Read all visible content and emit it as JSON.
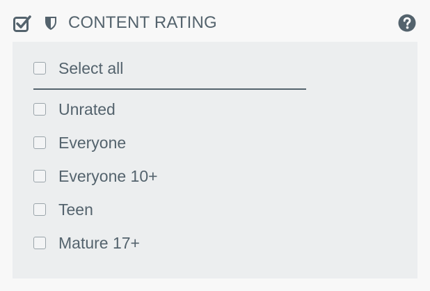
{
  "header": {
    "title": "CONTENT RATING",
    "check_icon": "checkbox-checked-icon",
    "shield_icon": "shield-icon",
    "help_icon": "question-circle-icon"
  },
  "select_all": {
    "label": "Select all",
    "checked": false
  },
  "options": [
    {
      "label": "Unrated",
      "checked": false
    },
    {
      "label": "Everyone",
      "checked": false
    },
    {
      "label": "Everyone 10+",
      "checked": false
    },
    {
      "label": "Teen",
      "checked": false
    },
    {
      "label": "Mature 17+",
      "checked": false
    }
  ],
  "colors": {
    "text": "#54636d",
    "panel_bg": "#eceeef",
    "page_bg": "#f8f8f8",
    "checkbox_border": "#9aa4aa"
  }
}
